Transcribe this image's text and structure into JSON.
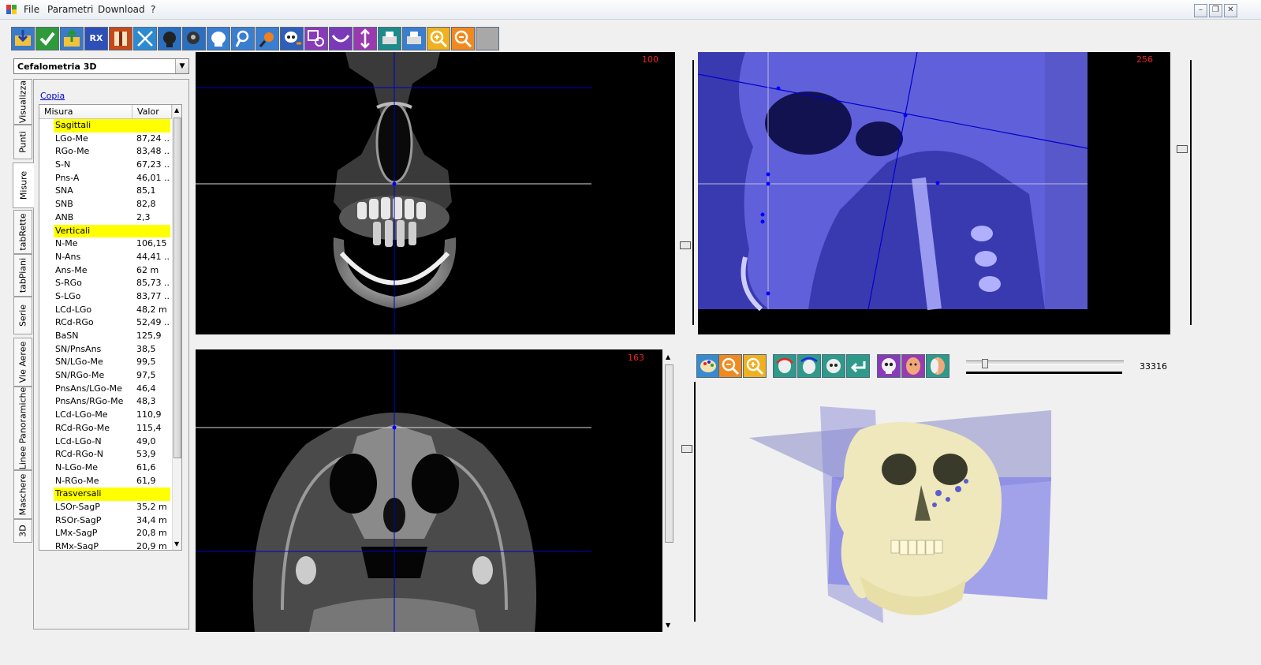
{
  "menubar": {
    "items": [
      "File",
      "Parametri",
      "Download",
      "?"
    ]
  },
  "toolbar": {
    "rx_label": "RX",
    "buttons": [
      "open-folder-icon",
      "confirm-check-icon",
      "export-folder-icon",
      "rx-icon",
      "book-icon",
      "expand-arrows-icon",
      "head-profile-icon",
      "head-side-icon",
      "skull-head-icon",
      "marker-icon",
      "search-head-icon",
      "skull-export-icon",
      "grid-search-icon",
      "arch-icon",
      "vertical-arrows-icon",
      "print-preview-icon",
      "print-icon",
      "zoom-in-icon",
      "zoom-out-icon",
      "blank-icon"
    ]
  },
  "left_panel": {
    "combo_value": "Cefalometria 3D",
    "tabs": [
      "Visualizza",
      "Punti",
      "Misure",
      "tabRette",
      "tabPiani",
      "Serie",
      "Vie Aeree",
      "Linee Panoramiche",
      "Maschere",
      "3D"
    ],
    "active_tab": "Misure",
    "copy_link": "Copia",
    "grid_headers": [
      "Misura",
      "Valor"
    ],
    "rows": [
      {
        "name": "Sagittali",
        "value": "",
        "group": true
      },
      {
        "name": "LGo-Me",
        "value": "87,24 ..."
      },
      {
        "name": "RGo-Me",
        "value": "83,48 ..."
      },
      {
        "name": "S-N",
        "value": "67,23 ..."
      },
      {
        "name": "Pns-A",
        "value": "46,01 ..."
      },
      {
        "name": "SNA",
        "value": "85,1"
      },
      {
        "name": "SNB",
        "value": "82,8"
      },
      {
        "name": "ANB",
        "value": "2,3"
      },
      {
        "name": "Verticali",
        "value": "",
        "group": true
      },
      {
        "name": "N-Me",
        "value": "106,15"
      },
      {
        "name": "N-Ans",
        "value": "44,41 ..."
      },
      {
        "name": "Ans-Me",
        "value": "62 m"
      },
      {
        "name": "S-RGo",
        "value": "85,73 ..."
      },
      {
        "name": "S-LGo",
        "value": "83,77 ..."
      },
      {
        "name": "LCd-LGo",
        "value": "48,2 m"
      },
      {
        "name": "RCd-RGo",
        "value": "52,49 ..."
      },
      {
        "name": "BaSN",
        "value": "125,9"
      },
      {
        "name": "SN/PnsAns",
        "value": "38,5"
      },
      {
        "name": "SN/LGo-Me",
        "value": "99,5"
      },
      {
        "name": "SN/RGo-Me",
        "value": "97,5"
      },
      {
        "name": "PnsAns/LGo-Me",
        "value": "46,4"
      },
      {
        "name": "PnsAns/RGo-Me",
        "value": "48,3"
      },
      {
        "name": "LCd-LGo-Me",
        "value": "110,9"
      },
      {
        "name": "RCd-RGo-Me",
        "value": "115,4"
      },
      {
        "name": "LCd-LGo-N",
        "value": "49,0"
      },
      {
        "name": "RCd-RGo-N",
        "value": "53,9"
      },
      {
        "name": "N-LGo-Me",
        "value": "61,6"
      },
      {
        "name": "N-RGo-Me",
        "value": "61,9"
      },
      {
        "name": "Trasversali",
        "value": "",
        "group": true
      },
      {
        "name": "LSOr-SagP",
        "value": "35,2 m"
      },
      {
        "name": "RSOr-SagP",
        "value": "34,4 m"
      },
      {
        "name": "LMx-SagP",
        "value": "20,8 m"
      },
      {
        "name": "RMx-SagP",
        "value": "20,9 m"
      }
    ]
  },
  "views": {
    "coronal_slice": "100",
    "sagittal_slice": "256",
    "axial_slice": "163"
  },
  "view3d": {
    "buttons": [
      "palette-icon",
      "zoom-out-icon",
      "zoom-in-icon",
      "rotate-left-icon",
      "rotate-top-icon",
      "rotate-front-icon",
      "undo-arrow-icon",
      "skull-icon",
      "face-soft-icon",
      "face-mixed-icon"
    ],
    "slider_value": "33316",
    "slider_level": 0.04
  },
  "colors": {
    "slice_label": "#ee2222",
    "plane_blue": "#0000cc",
    "sagittal_tint": "#3a3ab0",
    "group_highlight": "#ffff00"
  }
}
